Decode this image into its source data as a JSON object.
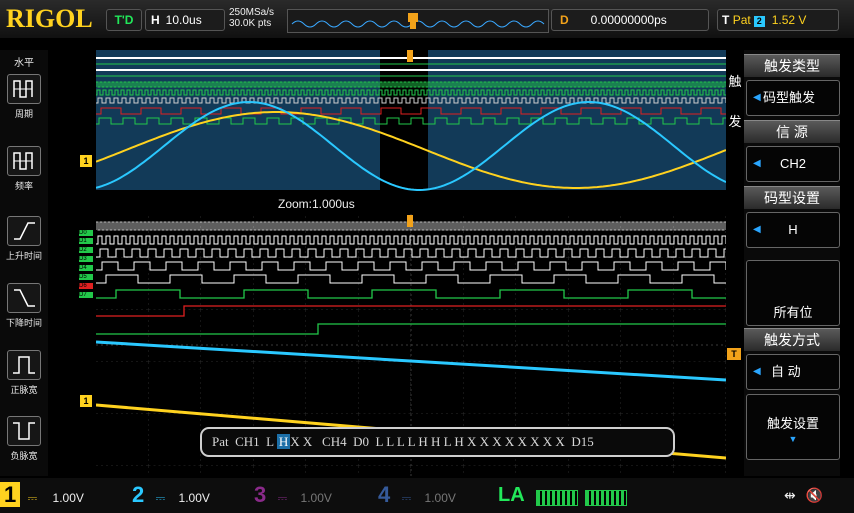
{
  "header": {
    "logo": "RIGOL",
    "run_mode": "T'D",
    "horizontal_key": "H",
    "horizontal_value": "10.0us",
    "sample_rate": "250MSa/s",
    "memory_depth": "30.0K pts",
    "delay_key": "D",
    "delay_value": "0.00000000ps",
    "trigger_key": "T",
    "trigger_type": "Pat",
    "trigger_source_badge": "2",
    "trigger_level": "1.52 V"
  },
  "left_menu": {
    "title": "水平",
    "items": [
      {
        "label": "周期",
        "icon": "period-icon"
      },
      {
        "label": "频率",
        "icon": "frequency-icon"
      },
      {
        "label": "上升时间",
        "icon": "rise-time-icon"
      },
      {
        "label": "下降时间",
        "icon": "fall-time-icon"
      },
      {
        "label": "正脉宽",
        "icon": "positive-width-icon"
      },
      {
        "label": "负脉宽",
        "icon": "negative-width-icon"
      }
    ]
  },
  "screen": {
    "zoom_label": "Zoom:1.000us",
    "channel_markers": [
      "D0",
      "D1",
      "D2",
      "D3",
      "D4",
      "D5",
      "D6",
      "D7"
    ],
    "ch1_marker": "1",
    "trigger_marker": "T",
    "pattern_status": "Pat  CH1  L H X X   CH4  D0  L L L L H H L H X X X X X X X X  D15",
    "pattern_prefix": "Pat  CH1  L ",
    "pattern_highlight": "H",
    "pattern_suffix": "X X   CH4  D0  L L L L H H L H X X X X X X X X  D15"
  },
  "right_menu": {
    "side_label": "触发",
    "items": [
      {
        "header": "触发类型",
        "value": "码型触发"
      },
      {
        "header": "信 源",
        "value": "CH2"
      },
      {
        "header": "码型设置",
        "value": "H"
      },
      {
        "header": "",
        "value": "所有位"
      },
      {
        "header": "触发方式",
        "value": "自 动"
      },
      {
        "header": "",
        "value": "触发设置"
      }
    ]
  },
  "bottom_bar": {
    "channels": [
      {
        "num": "1",
        "value": "1.00V",
        "color": "#ffd21f"
      },
      {
        "num": "2",
        "value": "1.00V",
        "color": "#2ac8ff"
      },
      {
        "num": "3",
        "value": "1.00V",
        "color": "#d040d0"
      },
      {
        "num": "4",
        "value": "1.00V",
        "color": "#3a7bd5"
      }
    ],
    "la_label": "LA"
  },
  "colors": {
    "ch1": "#ffd21f",
    "ch2": "#2ac8ff",
    "digital": "#22c84a",
    "digital_red": "#e02020",
    "zoom_background": "#123a58"
  }
}
